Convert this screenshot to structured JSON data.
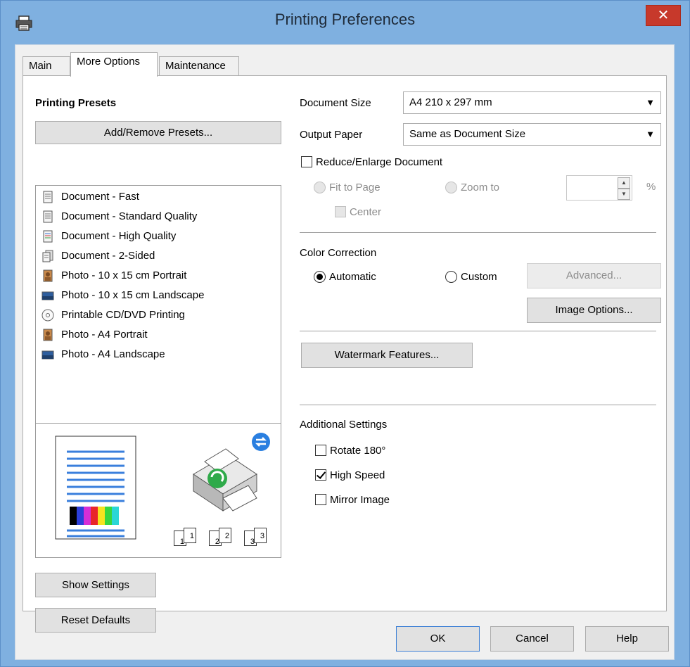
{
  "window": {
    "title": "Printing Preferences",
    "close": "✕"
  },
  "tabs": [
    {
      "label": "Main"
    },
    {
      "label": "More Options"
    },
    {
      "label": "Maintenance"
    }
  ],
  "presets": {
    "heading": "Printing Presets",
    "add_remove_label": "Add/Remove Presets...",
    "items": [
      {
        "label": "Document - Fast",
        "icon": "document-icon"
      },
      {
        "label": "Document - Standard Quality",
        "icon": "document-icon"
      },
      {
        "label": "Document - High Quality",
        "icon": "document-color-icon"
      },
      {
        "label": "Document - 2-Sided",
        "icon": "document-2sided-icon"
      },
      {
        "label": "Photo - 10 x 15 cm Portrait",
        "icon": "photo-portrait-icon"
      },
      {
        "label": "Photo - 10 x 15 cm Landscape",
        "icon": "photo-landscape-icon"
      },
      {
        "label": "Printable CD/DVD Printing",
        "icon": "cd-icon"
      },
      {
        "label": "Photo - A4 Portrait",
        "icon": "photo-portrait-icon"
      },
      {
        "label": "Photo - A4 Landscape",
        "icon": "photo-landscape-icon"
      }
    ],
    "copy_numbers": [
      "1",
      "1",
      "2",
      "2",
      "3",
      "3"
    ]
  },
  "left_buttons": {
    "show_settings": "Show Settings",
    "reset_defaults": "Reset Defaults"
  },
  "document_size": {
    "label": "Document Size",
    "value": "A4 210 x 297 mm"
  },
  "output_paper": {
    "label": "Output Paper",
    "value": "Same as Document Size"
  },
  "reduce_enlarge": {
    "label": "Reduce/Enlarge Document",
    "checked": false,
    "fit_to_page": "Fit to Page",
    "zoom_to": "Zoom to",
    "zoom_value": "",
    "percent": "%",
    "center": "Center"
  },
  "color_correction": {
    "heading": "Color Correction",
    "automatic": "Automatic",
    "custom": "Custom",
    "advanced": "Advanced...",
    "image_options": "Image Options..."
  },
  "watermark": {
    "label": "Watermark Features..."
  },
  "additional": {
    "heading": "Additional Settings",
    "rotate": "Rotate 180°",
    "high_speed": "High Speed",
    "mirror": "Mirror Image"
  },
  "dialog_buttons": {
    "ok": "OK",
    "cancel": "Cancel",
    "help": "Help"
  },
  "colors": {
    "accent": "#3c7fd5",
    "close": "#c7392b",
    "frame": "#7fb0e0"
  }
}
